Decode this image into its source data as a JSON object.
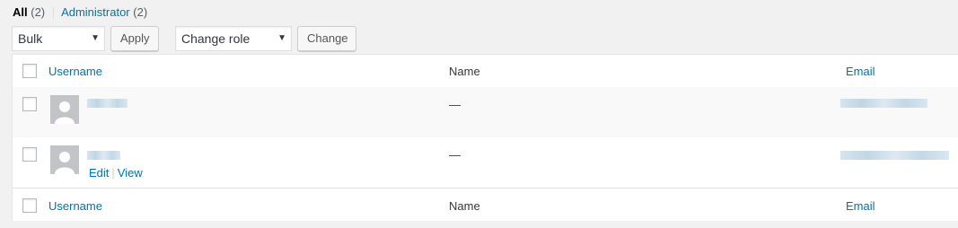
{
  "filters": {
    "all_label": "All",
    "all_count": "(2)",
    "separator": "|",
    "admin_label": "Administrator",
    "admin_count": "(2)"
  },
  "toolbar": {
    "bulk_actions": "Bulk Actions",
    "apply": "Apply",
    "change_role": "Change role to…",
    "change": "Change"
  },
  "table": {
    "columns": {
      "username": "Username",
      "name": "Name",
      "email": "Email"
    },
    "rows": [
      {
        "name": "—",
        "actions": []
      },
      {
        "name": "—",
        "actions": [
          "Edit",
          "View"
        ]
      }
    ],
    "action_separator": "|"
  },
  "colors": {
    "link": "#0073aa",
    "background": "#f1f1f1",
    "alt_row": "#f9f9f9",
    "avatar": "#c3c4c7",
    "redaction": "#bcd3e4"
  }
}
